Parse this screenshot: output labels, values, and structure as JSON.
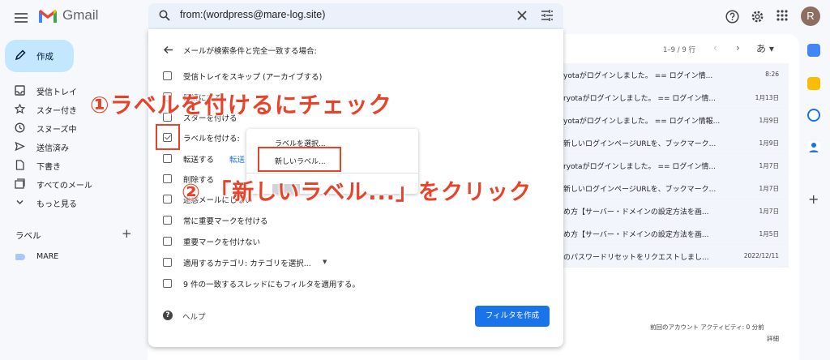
{
  "header": {
    "app_name": "Gmail",
    "search_query": "from:(wordpress@mare-log.site)",
    "avatar_initial": "R"
  },
  "sidebar": {
    "compose_label": "作成",
    "items": [
      {
        "label": "受信トレイ",
        "icon": "inbox-icon"
      },
      {
        "label": "スター付き",
        "icon": "star-icon"
      },
      {
        "label": "スヌーズ中",
        "icon": "clock-icon"
      },
      {
        "label": "送信済み",
        "icon": "send-icon"
      },
      {
        "label": "下書き",
        "icon": "draft-icon"
      },
      {
        "label": "すべてのメール",
        "icon": "all-mail-icon"
      },
      {
        "label": "もっと見る",
        "icon": "chevron-down-icon"
      }
    ],
    "labels_heading": "ラベル",
    "labels_add": "+",
    "labels": [
      {
        "name": "MARE",
        "color": "#a8c7fa"
      }
    ]
  },
  "list": {
    "pagination": "1–9 / 9 行",
    "lang_button": "あ ▾",
    "rows": [
      {
        "snippet": "yotaがログインしました。 == ログイン情...",
        "date": "8:26"
      },
      {
        "snippet": "ryotaがログインしました。 == ログイン情...",
        "date": "1月13日"
      },
      {
        "snippet": "yotaがログインしました。 == ログイン情報...",
        "date": "1月9日"
      },
      {
        "snippet": "新しいログインページURLを、ブックマーク...",
        "date": "1月9日"
      },
      {
        "snippet": "ryotaがログインしました。 == ログイン情...",
        "date": "1月7日"
      },
      {
        "snippet": "新しいログインページURLを、ブックマーク...",
        "date": "1月7日"
      },
      {
        "snippet": "め方【サーバー・ドメインの設定方法を画...",
        "date": "1月7日"
      },
      {
        "snippet": "め方【サーバー・ドメインの設定方法を画...",
        "date": "1月5日"
      },
      {
        "snippet": "のパスワードリセットをリクエストしまし...",
        "date": "2022/12/11"
      }
    ],
    "activity": "前回のアカウント アクティビティ: 0 分前",
    "details": "詳細"
  },
  "filter_dialog": {
    "criteria_text": "メールが検索条件と完全一致する場合:",
    "options": [
      {
        "label": "受信トレイをスキップ (アーカイブする)",
        "checked": false
      },
      {
        "label": "既読にする",
        "checked": false
      },
      {
        "label": "スターを付ける",
        "checked": false
      },
      {
        "label": "ラベルを付ける:",
        "checked": true
      },
      {
        "label": "転送する",
        "checked": false
      },
      {
        "label": "削除する",
        "checked": false
      },
      {
        "label": "迷惑メールにしない",
        "checked": false
      },
      {
        "label": "常に重要マークを付ける",
        "checked": false
      },
      {
        "label": "重要マークを付けない",
        "checked": false
      },
      {
        "label": "適用するカテゴリ: カテゴリを選択...",
        "checked": false
      },
      {
        "label": "9 件の一致するスレッドにもフィルタを適用する。",
        "checked": false
      }
    ],
    "forward_link": "転送",
    "category_dropdown": "▼",
    "help_label": "ヘルプ",
    "create_button": "フィルタを作成"
  },
  "label_popup": {
    "select_label": "ラベルを選択...",
    "new_label": "新しいラベル..."
  },
  "annotations": {
    "step1": "①ラベルを付けるにチェック",
    "step2": "② 「新しいラベル...」をクリック",
    "color": "#e8432a"
  }
}
